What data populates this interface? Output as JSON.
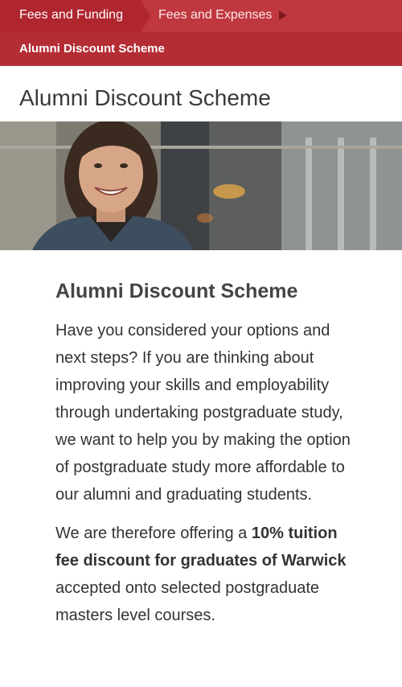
{
  "breadcrumb": {
    "level1": "Fees and Funding",
    "level2": "Fees and Expenses",
    "current": "Alumni Discount Scheme"
  },
  "page": {
    "title": "Alumni Discount Scheme"
  },
  "article": {
    "heading": "Alumni Discount Scheme",
    "paragraph1": "Have you considered your options and next steps? If you are thinking about improving your skills and employability through undertaking postgraduate study, we want to help you by making the option of postgraduate study more affordable to our alumni and graduating students.",
    "paragraph2_prefix": "We are therefore offering a ",
    "paragraph2_bold": "10% tuition fee discount for graduates of Warwick",
    "paragraph2_suffix": " accepted onto selected postgraduate masters level courses."
  },
  "colors": {
    "brand_red": "#c0383f",
    "brand_red_dark": "#b0262f"
  },
  "icons": {
    "breadcrumb_caret": "caret-right-icon"
  }
}
